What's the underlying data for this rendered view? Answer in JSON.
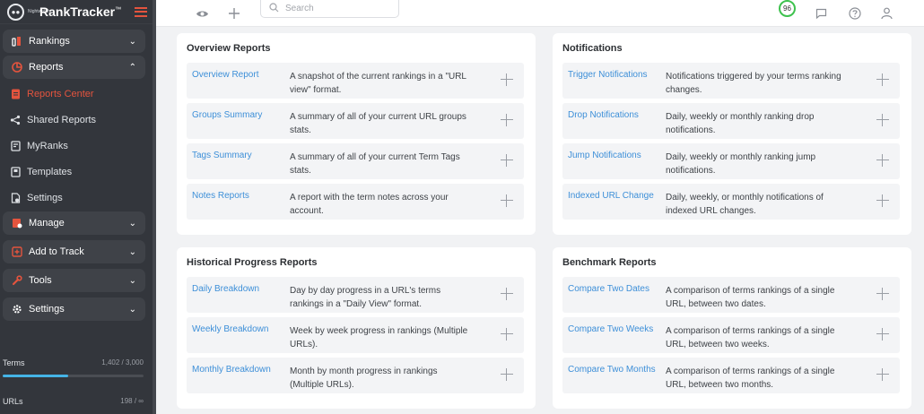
{
  "app": {
    "logo_small": "Nightwatch",
    "logo_text": "RankTracker",
    "logo_mark": "™"
  },
  "sidebar": {
    "items": [
      {
        "label": "Rankings",
        "icon": "rankings-icon",
        "chevron": "⌄",
        "type": "pill"
      },
      {
        "label": "Reports",
        "icon": "reports-icon",
        "chevron": "⌃",
        "type": "pill"
      },
      {
        "label": "Reports Center",
        "icon": "reports-center-icon",
        "type": "sub",
        "active": true
      },
      {
        "label": "Shared Reports",
        "icon": "share-icon",
        "type": "sub"
      },
      {
        "label": "MyRanks",
        "icon": "myranks-icon",
        "type": "sub"
      },
      {
        "label": "Templates",
        "icon": "templates-icon",
        "type": "sub"
      },
      {
        "label": "Settings",
        "icon": "settings-doc-icon",
        "type": "sub"
      },
      {
        "label": "Manage",
        "icon": "manage-icon",
        "chevron": "⌄",
        "type": "pill"
      },
      {
        "label": "Add to Track",
        "icon": "add-track-icon",
        "chevron": "⌄",
        "type": "pill"
      },
      {
        "label": "Tools",
        "icon": "tools-icon",
        "chevron": "⌄",
        "type": "pill"
      },
      {
        "label": "Settings",
        "icon": "gear-icon",
        "chevron": "⌄",
        "type": "pill"
      }
    ],
    "meters": [
      {
        "label": "Terms",
        "value": "1,402 / 3,000",
        "fraction": 0.467
      },
      {
        "label": "URLs",
        "value": "198 / ∞"
      }
    ]
  },
  "topbar": {
    "search_placeholder": "Search",
    "score": "96"
  },
  "sections": {
    "overview": {
      "title": "Overview Reports",
      "rows": [
        {
          "link": "Overview Report",
          "desc": "A snapshot of the current rankings in a \"URL view\" format."
        },
        {
          "link": "Groups Summary",
          "desc": "A summary of all of your current URL groups stats."
        },
        {
          "link": "Tags Summary",
          "desc": "A summary of all of your current Term Tags stats."
        },
        {
          "link": "Notes Reports",
          "desc": "A report with the term notes across your account."
        }
      ]
    },
    "notifications": {
      "title": "Notifications",
      "rows": [
        {
          "link": "Trigger Notifications",
          "desc": "Notifications triggered by your terms ranking changes."
        },
        {
          "link": "Drop Notifications",
          "desc": "Daily, weekly or monthly ranking drop notifications."
        },
        {
          "link": "Jump Notifications",
          "desc": "Daily, weekly or monthly ranking jump notifications."
        },
        {
          "link": "Indexed URL Change",
          "desc": "Daily, weekly, or monthly notifications of indexed URL changes."
        }
      ]
    },
    "historical": {
      "title": "Historical Progress Reports",
      "rows": [
        {
          "link": "Daily Breakdown",
          "desc": "Day by day progress in a URL's terms rankings in a \"Daily View\" format."
        },
        {
          "link": "Weekly Breakdown",
          "desc": "Week by week progress in rankings (Multiple URLs)."
        },
        {
          "link": "Monthly Breakdown",
          "desc": "Month by month progress in rankings (Multiple URLs)."
        }
      ]
    },
    "benchmark": {
      "title": "Benchmark Reports",
      "rows": [
        {
          "link": "Compare Two Dates",
          "desc": "A comparison of terms rankings of a single URL, between two dates."
        },
        {
          "link": "Compare Two Weeks",
          "desc": "A comparison of terms rankings of a single URL, between two weeks."
        },
        {
          "link": "Compare Two Months",
          "desc": "A comparison of terms rankings of a single URL, between two months."
        }
      ]
    }
  },
  "colors": {
    "accent": "#e4543e",
    "link": "#3d8fd8",
    "sidebar_bg": "#33363c",
    "score_ring": "#3ec24e",
    "meter_fill": "#45b4e6"
  }
}
